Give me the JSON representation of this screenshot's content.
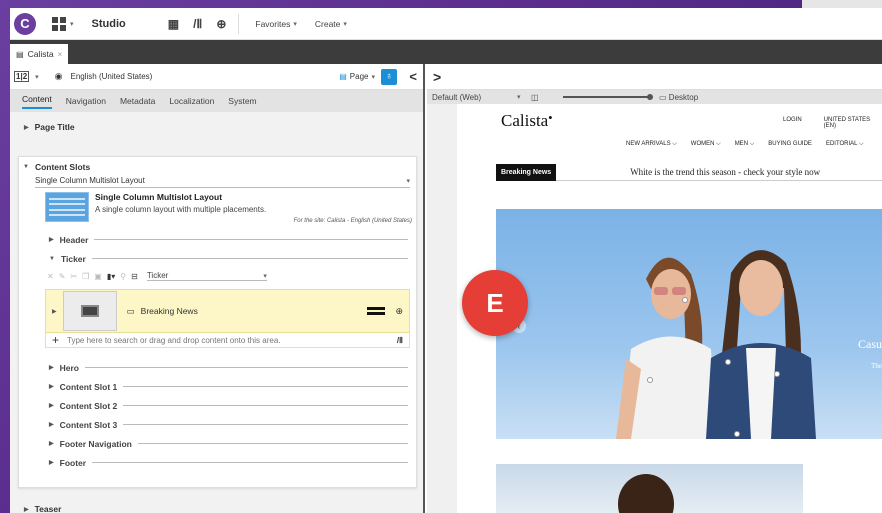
{
  "topbar": {
    "app_name": "Studio",
    "favorites": "Favorites",
    "create": "Create"
  },
  "tab": {
    "label": "Calista",
    "close": "×"
  },
  "left": {
    "lang": "English (United States)",
    "page_btn": "Page",
    "form_tabs": [
      "Content",
      "Navigation",
      "Metadata",
      "Localization",
      "System"
    ],
    "page_title_section": "Page Title",
    "content_slots": "Content Slots",
    "layout_select": "Single Column Multislot Layout",
    "layout_title": "Single Column Multislot Layout",
    "layout_desc": "A single column layout with multiple placements.",
    "for_site": "For the site: Calista - English (United States)",
    "slots_top": [
      "Header",
      "Ticker"
    ],
    "ticker_select": "Ticker",
    "breaking_news": "Breaking News",
    "search_placeholder": "Type here to search or drag and drop content onto this area.",
    "slots_bottom": [
      "Hero",
      "Content Slot 1",
      "Content Slot 2",
      "Content Slot 3",
      "Footer Navigation",
      "Footer"
    ],
    "teaser": "Teaser"
  },
  "right": {
    "device": "Default (Web)",
    "desktop": "Desktop",
    "site": {
      "brand": "Calista",
      "login": "LOGIN",
      "region": "UNITED STATES (EN)",
      "nav": [
        "NEW ARRIVALS",
        "WOMEN",
        "MEN",
        "BUYING GUIDE",
        "EDITORIAL"
      ],
      "breaking_tag": "Breaking News",
      "breaking_msg": "White is the trend this season - check your style now",
      "hero_caption": "Casu",
      "hero_caption2": "The"
    }
  },
  "badge": "E",
  "colors": {
    "accent": "#1a8fd6",
    "badge": "#e53e36",
    "brand": "#6b3fa0",
    "highlight": "#fdf7c8"
  }
}
